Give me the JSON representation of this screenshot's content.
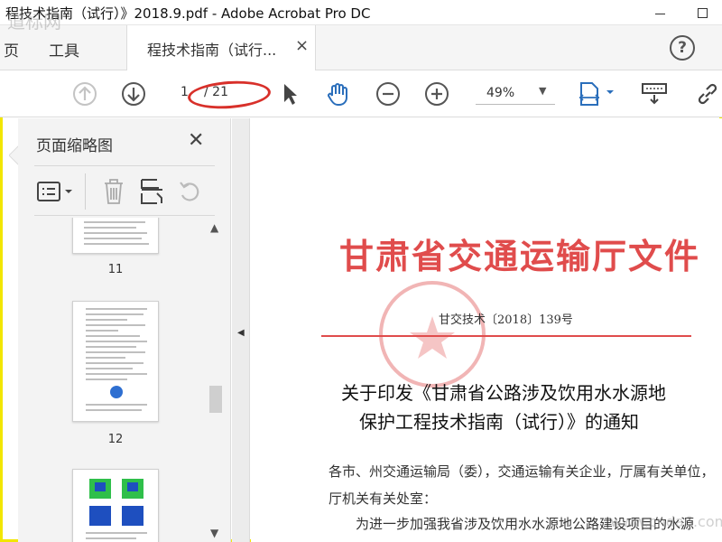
{
  "window": {
    "title": "程技术指南（试行）》2018.9.pdf - Adobe Acrobat Pro DC",
    "minimize_label": "—",
    "colors": {
      "frame": "#f2e600",
      "accent": "#2a6ebb",
      "stamp_red": "#e04c4c",
      "annotation_red": "#d8302a"
    }
  },
  "menu": {
    "items": [
      "页",
      "工具"
    ],
    "tab_label": "程技术指南（试行...",
    "tab_close": "×",
    "help": "?"
  },
  "toolbar": {
    "page_current": "1",
    "page_total": "/ 21",
    "zoom": "49%",
    "zoom_caret": "▼",
    "icons": [
      "arrow-up-icon",
      "arrow-down-icon",
      "select-pointer-icon",
      "hand-tool-icon",
      "zoom-out-icon",
      "zoom-in-icon",
      "fit-page-icon",
      "scroll-mode-icon",
      "link-icon"
    ]
  },
  "panel": {
    "title": "页面缩略图",
    "close": "✕",
    "tools": [
      "thumbnail-options-icon",
      "delete-icon",
      "insert-page-icon",
      "rotate-icon"
    ],
    "thumbnails": [
      {
        "number": "11"
      },
      {
        "number": "12"
      },
      {
        "number": ""
      }
    ]
  },
  "document": {
    "title": "甘肃省交通运输厅文件",
    "doc_number": "甘交技术〔2018〕139号",
    "heading_line1": "关于印发《甘肃省公路涉及饮用水水源地",
    "heading_line2": "保护工程技术指南（试行）》的通知",
    "body_line1": "各市、州交通运输局（委），交通运输有关企业，厅属有关单位，",
    "body_line2": "厅机关有关处室：",
    "body_line3": "为进一步加强我省涉及饮用水水源地公路建设项目的水源"
  },
  "watermarks": {
    "top_left": "道标网",
    "bottom_right": "www.cnda6.com"
  }
}
